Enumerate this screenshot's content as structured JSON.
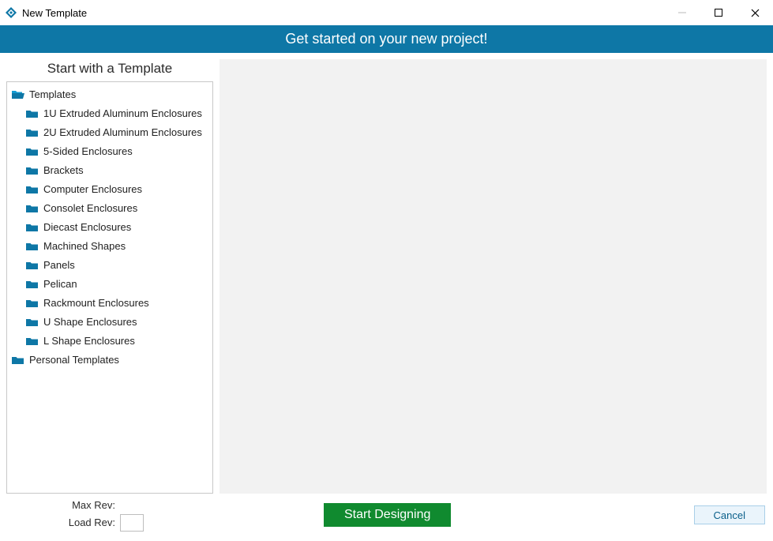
{
  "window": {
    "title": "New Template"
  },
  "banner": {
    "text": "Get started on your new project!"
  },
  "panel": {
    "title": "Start with a Template"
  },
  "tree": {
    "root": {
      "label": "Templates"
    },
    "items": [
      {
        "label": "1U Extruded Aluminum Enclosures"
      },
      {
        "label": "2U Extruded Aluminum Enclosures"
      },
      {
        "label": "5-Sided Enclosures"
      },
      {
        "label": "Brackets"
      },
      {
        "label": "Computer Enclosures"
      },
      {
        "label": "Consolet Enclosures"
      },
      {
        "label": "Diecast Enclosures"
      },
      {
        "label": "Machined Shapes"
      },
      {
        "label": "Panels"
      },
      {
        "label": "Pelican"
      },
      {
        "label": "Rackmount Enclosures"
      },
      {
        "label": "U Shape Enclosures"
      },
      {
        "label": "L Shape Enclosures"
      }
    ],
    "personal": {
      "label": "Personal Templates"
    }
  },
  "footer": {
    "max_rev_label": "Max Rev:",
    "load_rev_label": "Load Rev:",
    "load_rev_value": "",
    "start_label": "Start Designing",
    "cancel_label": "Cancel"
  },
  "colors": {
    "banner_bg": "#0e77a6",
    "start_bg": "#108a2f",
    "folder": "#0e77a6"
  }
}
